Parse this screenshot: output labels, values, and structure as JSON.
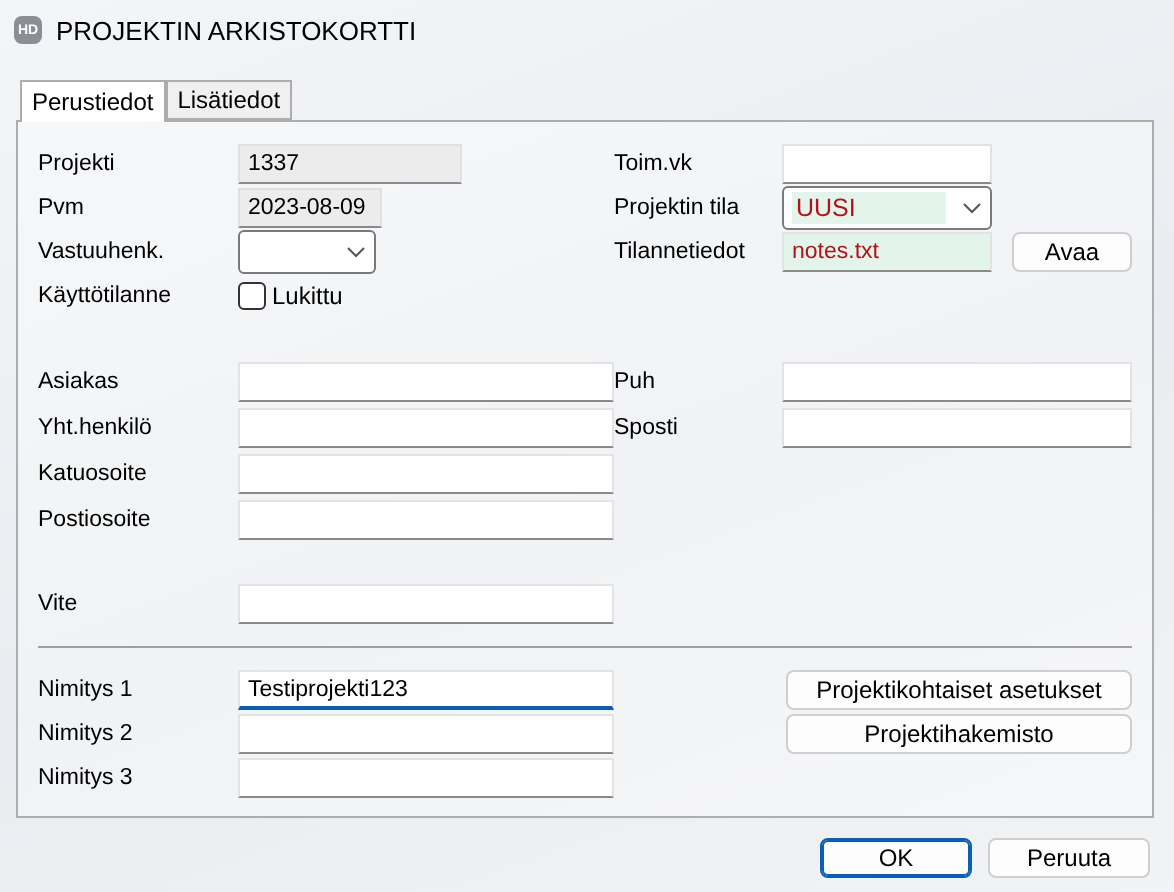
{
  "window": {
    "logo": "HD",
    "title": "PROJEKTIN ARKISTOKORTTI"
  },
  "tabs": [
    {
      "label": "Perustiedot",
      "selected": true
    },
    {
      "label": "Lisätiedot",
      "selected": false
    }
  ],
  "status_section": [
    {
      "left": {
        "kind": "text",
        "label": "Projekti",
        "value": "1337",
        "readonly": true
      },
      "right": {
        "kind": "text",
        "label": "Toim.vk"
      }
    },
    {
      "left": {
        "kind": "text",
        "label": "Pvm",
        "value": "2023-08-09",
        "readonly": true
      },
      "right": {
        "kind": "combo",
        "label": "Projektin tila",
        "value": "UUSI",
        "highlighted": true
      }
    },
    {
      "left": {
        "kind": "combo",
        "label": "Vastuuhenk."
      },
      "right": {
        "kind": "text",
        "label": "Tilannetiedot",
        "value": "notes.txt",
        "highlighted": true,
        "button": "Avaa"
      }
    },
    {
      "left": {
        "kind": "checkbox",
        "label": "Käyttötilanne",
        "option": "Lukittu",
        "checked": false
      }
    }
  ],
  "customer_section": [
    {
      "left": {
        "kind": "text",
        "label": "Asiakas"
      },
      "right": {
        "kind": "text",
        "label": "Puh"
      }
    },
    {
      "left": {
        "kind": "text",
        "label": "Yht.henkilö"
      },
      "right": {
        "kind": "text",
        "label": "Sposti"
      }
    },
    {
      "left": {
        "kind": "text",
        "label": "Katuosoite"
      }
    },
    {
      "left": {
        "kind": "text",
        "label": "Postiosoite"
      }
    }
  ],
  "reference": {
    "label": "Vite"
  },
  "names": [
    {
      "label": "Nimitys 1",
      "value": "Testiprojekti123",
      "focused": true,
      "button": "Projektikohtaiset asetukset"
    },
    {
      "label": "Nimitys 2",
      "focused": false,
      "button": "Projektihakemisto"
    },
    {
      "label": "Nimitys 3",
      "focused": false
    }
  ],
  "buttons": [
    {
      "label": "OK",
      "default": true
    },
    {
      "label": "Peruuta",
      "default": false
    }
  ]
}
